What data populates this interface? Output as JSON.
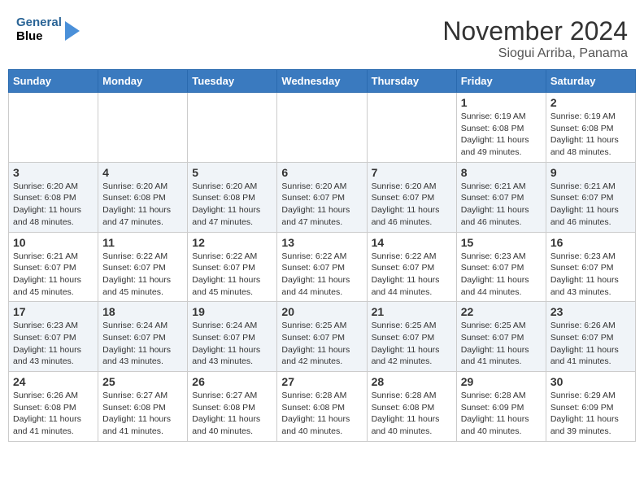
{
  "header": {
    "logo_line1": "General",
    "logo_line2": "Blue",
    "title": "November 2024",
    "subtitle": "Siogui Arriba, Panama"
  },
  "weekdays": [
    "Sunday",
    "Monday",
    "Tuesday",
    "Wednesday",
    "Thursday",
    "Friday",
    "Saturday"
  ],
  "weeks": [
    [
      {
        "day": "",
        "info": ""
      },
      {
        "day": "",
        "info": ""
      },
      {
        "day": "",
        "info": ""
      },
      {
        "day": "",
        "info": ""
      },
      {
        "day": "",
        "info": ""
      },
      {
        "day": "1",
        "info": "Sunrise: 6:19 AM\nSunset: 6:08 PM\nDaylight: 11 hours\nand 49 minutes."
      },
      {
        "day": "2",
        "info": "Sunrise: 6:19 AM\nSunset: 6:08 PM\nDaylight: 11 hours\nand 48 minutes."
      }
    ],
    [
      {
        "day": "3",
        "info": "Sunrise: 6:20 AM\nSunset: 6:08 PM\nDaylight: 11 hours\nand 48 minutes."
      },
      {
        "day": "4",
        "info": "Sunrise: 6:20 AM\nSunset: 6:08 PM\nDaylight: 11 hours\nand 47 minutes."
      },
      {
        "day": "5",
        "info": "Sunrise: 6:20 AM\nSunset: 6:08 PM\nDaylight: 11 hours\nand 47 minutes."
      },
      {
        "day": "6",
        "info": "Sunrise: 6:20 AM\nSunset: 6:07 PM\nDaylight: 11 hours\nand 47 minutes."
      },
      {
        "day": "7",
        "info": "Sunrise: 6:20 AM\nSunset: 6:07 PM\nDaylight: 11 hours\nand 46 minutes."
      },
      {
        "day": "8",
        "info": "Sunrise: 6:21 AM\nSunset: 6:07 PM\nDaylight: 11 hours\nand 46 minutes."
      },
      {
        "day": "9",
        "info": "Sunrise: 6:21 AM\nSunset: 6:07 PM\nDaylight: 11 hours\nand 46 minutes."
      }
    ],
    [
      {
        "day": "10",
        "info": "Sunrise: 6:21 AM\nSunset: 6:07 PM\nDaylight: 11 hours\nand 45 minutes."
      },
      {
        "day": "11",
        "info": "Sunrise: 6:22 AM\nSunset: 6:07 PM\nDaylight: 11 hours\nand 45 minutes."
      },
      {
        "day": "12",
        "info": "Sunrise: 6:22 AM\nSunset: 6:07 PM\nDaylight: 11 hours\nand 45 minutes."
      },
      {
        "day": "13",
        "info": "Sunrise: 6:22 AM\nSunset: 6:07 PM\nDaylight: 11 hours\nand 44 minutes."
      },
      {
        "day": "14",
        "info": "Sunrise: 6:22 AM\nSunset: 6:07 PM\nDaylight: 11 hours\nand 44 minutes."
      },
      {
        "day": "15",
        "info": "Sunrise: 6:23 AM\nSunset: 6:07 PM\nDaylight: 11 hours\nand 44 minutes."
      },
      {
        "day": "16",
        "info": "Sunrise: 6:23 AM\nSunset: 6:07 PM\nDaylight: 11 hours\nand 43 minutes."
      }
    ],
    [
      {
        "day": "17",
        "info": "Sunrise: 6:23 AM\nSunset: 6:07 PM\nDaylight: 11 hours\nand 43 minutes."
      },
      {
        "day": "18",
        "info": "Sunrise: 6:24 AM\nSunset: 6:07 PM\nDaylight: 11 hours\nand 43 minutes."
      },
      {
        "day": "19",
        "info": "Sunrise: 6:24 AM\nSunset: 6:07 PM\nDaylight: 11 hours\nand 43 minutes."
      },
      {
        "day": "20",
        "info": "Sunrise: 6:25 AM\nSunset: 6:07 PM\nDaylight: 11 hours\nand 42 minutes."
      },
      {
        "day": "21",
        "info": "Sunrise: 6:25 AM\nSunset: 6:07 PM\nDaylight: 11 hours\nand 42 minutes."
      },
      {
        "day": "22",
        "info": "Sunrise: 6:25 AM\nSunset: 6:07 PM\nDaylight: 11 hours\nand 41 minutes."
      },
      {
        "day": "23",
        "info": "Sunrise: 6:26 AM\nSunset: 6:07 PM\nDaylight: 11 hours\nand 41 minutes."
      }
    ],
    [
      {
        "day": "24",
        "info": "Sunrise: 6:26 AM\nSunset: 6:08 PM\nDaylight: 11 hours\nand 41 minutes."
      },
      {
        "day": "25",
        "info": "Sunrise: 6:27 AM\nSunset: 6:08 PM\nDaylight: 11 hours\nand 41 minutes."
      },
      {
        "day": "26",
        "info": "Sunrise: 6:27 AM\nSunset: 6:08 PM\nDaylight: 11 hours\nand 40 minutes."
      },
      {
        "day": "27",
        "info": "Sunrise: 6:28 AM\nSunset: 6:08 PM\nDaylight: 11 hours\nand 40 minutes."
      },
      {
        "day": "28",
        "info": "Sunrise: 6:28 AM\nSunset: 6:08 PM\nDaylight: 11 hours\nand 40 minutes."
      },
      {
        "day": "29",
        "info": "Sunrise: 6:28 AM\nSunset: 6:09 PM\nDaylight: 11 hours\nand 40 minutes."
      },
      {
        "day": "30",
        "info": "Sunrise: 6:29 AM\nSunset: 6:09 PM\nDaylight: 11 hours\nand 39 minutes."
      }
    ]
  ]
}
